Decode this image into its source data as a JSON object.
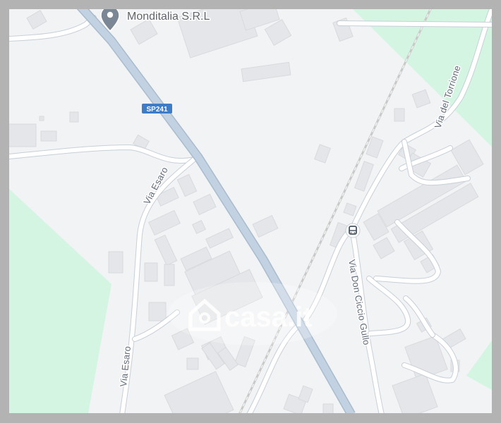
{
  "map": {
    "poi": {
      "name": "Monditalia S.R.L",
      "icon": "location-pin-icon"
    },
    "route_shield": {
      "ref": "SP241",
      "color": "#3f7cc8"
    },
    "streets": {
      "via_esaro_upper": "Via Esaro",
      "via_esaro_lower": "Via Esaro",
      "via_del_torrione": "Via del Torrione",
      "via_don_ciccio_gullo": "Via Don Ciccio Gullo"
    },
    "transit_icon": "bus-stop-icon",
    "watermark": {
      "brand": "casa.it",
      "icon": "house-logo-icon"
    },
    "colors": {
      "background": "#f2f3f4",
      "park": "#d4f5e2",
      "highway": "#c3d2e2",
      "road": "#ffffff",
      "building": "#e4e6e9",
      "railway": "#c9c9c9",
      "frame": "#b3b3b3"
    }
  }
}
